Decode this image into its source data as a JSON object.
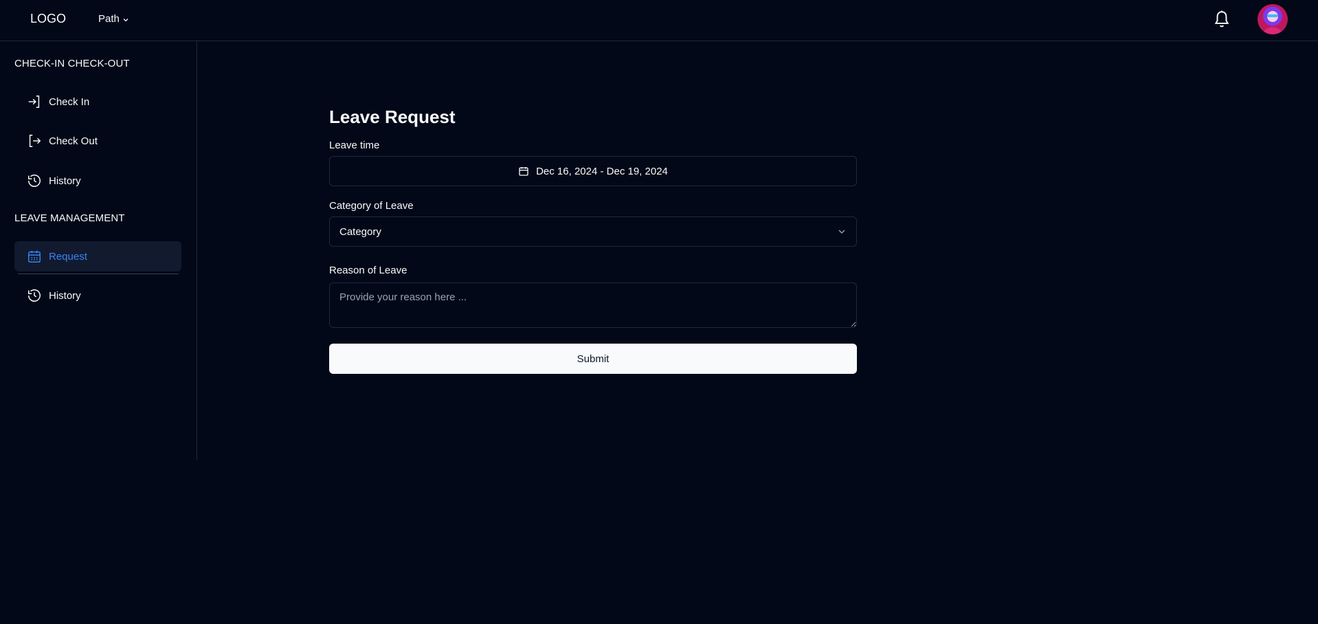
{
  "header": {
    "logo": "LOGO",
    "path_label": "Path"
  },
  "sidebar": {
    "section_checkin": "CHECK-IN CHECK-OUT",
    "checkin_items": [
      {
        "label": "Check In",
        "icon": "log-in-icon"
      },
      {
        "label": "Check Out",
        "icon": "log-out-icon"
      },
      {
        "label": "History",
        "icon": "history-icon"
      }
    ],
    "section_leave": "LEAVE MANAGEMENT",
    "leave_items": [
      {
        "label": "Request",
        "icon": "calendar-icon",
        "active": true
      },
      {
        "label": "History",
        "icon": "history-icon"
      }
    ]
  },
  "form": {
    "title": "Leave Request",
    "leave_time_label": "Leave time",
    "date_range": "Dec 16, 2024 - Dec 19, 2024",
    "category_label": "Category of Leave",
    "category_value": "Category",
    "reason_label": "Reason of Leave",
    "reason_placeholder": "Provide your reason here ...",
    "submit_label": "Submit"
  },
  "colors": {
    "background": "#020817",
    "accent": "#3b82f6",
    "border": "#1e293b"
  }
}
